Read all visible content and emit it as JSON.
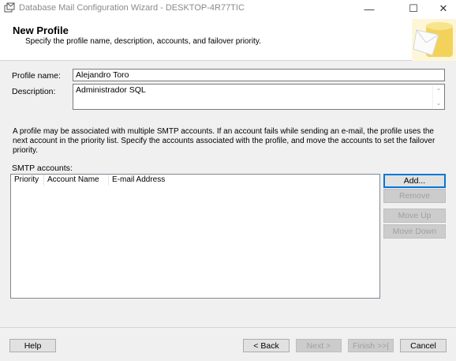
{
  "window": {
    "title": "Database Mail Configuration Wizard - DESKTOP-4R77TIC",
    "minimize_glyph": "—",
    "maximize_glyph": "☐",
    "close_glyph": "✕",
    "icon": "database-mail-icon"
  },
  "header": {
    "title": "New Profile",
    "subtitle": "Specify the profile name, description, accounts, and failover priority.",
    "graphic": "database-mail-graphic"
  },
  "form": {
    "profile_name_label": "Profile name:",
    "profile_name_value": "Alejandro Toro",
    "description_label": "Description:",
    "description_value": "Administrador SQL"
  },
  "info_text": "A profile may be associated with multiple SMTP accounts. If an account fails while sending an e-mail, the profile uses the next account in the priority list. Specify the accounts associated with the profile, and move the accounts to set the failover priority.",
  "smtp": {
    "label": "SMTP accounts:",
    "columns": [
      "Priority",
      "Account Name",
      "E-mail Address"
    ],
    "rows": []
  },
  "side_buttons": {
    "add": "Add...",
    "remove": "Remove",
    "move_up": "Move Up",
    "move_down": "Move Down"
  },
  "footer": {
    "help": "Help",
    "back": "< Back",
    "next": "Next >",
    "finish": "Finish >>|",
    "cancel": "Cancel"
  },
  "colors": {
    "accent": "#0078d7",
    "panel": "#f0f0f0"
  }
}
